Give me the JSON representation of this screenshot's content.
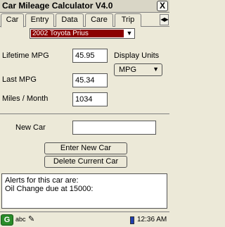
{
  "window": {
    "title": "Car Mileage Calculator V4.0",
    "close_label": "X"
  },
  "tabs": [
    {
      "label": "Car"
    },
    {
      "label": "Entry"
    },
    {
      "label": "Data"
    },
    {
      "label": "Care"
    },
    {
      "label": "Trip"
    }
  ],
  "car_select": {
    "value": "2002 Toyota Prius",
    "arrow": "▼"
  },
  "stats": {
    "lifetime_mpg_label": "Lifetime MPG",
    "lifetime_mpg_value": "45.95",
    "last_mpg_label": "Last MPG",
    "last_mpg_value": "45.34",
    "miles_month_label": "Miles / Month",
    "miles_month_value": "1034"
  },
  "display_units": {
    "label": "Display Units",
    "value": "MPG",
    "arrow": "▼"
  },
  "new_car": {
    "label": "New Car",
    "value": ""
  },
  "buttons": {
    "enter_new_car": "Enter New Car",
    "delete_current_car": "Delete Current Car"
  },
  "alerts": {
    "line1": "Alerts for this car are:",
    "line2": "Oil Change due at 15000:"
  },
  "taskbar": {
    "input_mode": "abc",
    "clock": "12:36 AM"
  }
}
